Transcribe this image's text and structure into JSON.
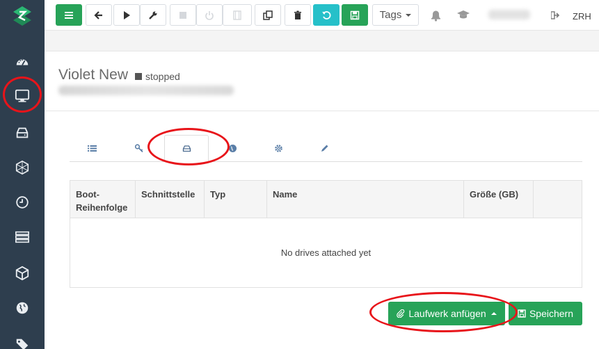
{
  "sidebar": {
    "items": [
      {
        "icon": "dashboard-gauge-icon"
      },
      {
        "icon": "monitor-icon"
      },
      {
        "icon": "hard-drive-icon"
      },
      {
        "icon": "network-hex-icon"
      },
      {
        "icon": "clock-icon"
      },
      {
        "icon": "server-rack-icon"
      },
      {
        "icon": "cube-icon"
      },
      {
        "icon": "globe-icon"
      },
      {
        "icon": "tag-icon"
      }
    ]
  },
  "toolbar": {
    "tags_label": "Tags",
    "region_label": "ZRH"
  },
  "vm": {
    "name": "Violet New",
    "status": "stopped"
  },
  "tabs": [
    {
      "icon": "list-icon"
    },
    {
      "icon": "key-icon"
    },
    {
      "icon": "drive-icon",
      "active": true
    },
    {
      "icon": "globe-icon"
    },
    {
      "icon": "gear-icon"
    },
    {
      "icon": "pencil-icon"
    }
  ],
  "drives_table": {
    "columns": [
      "Boot-\nReihenfolge",
      "Schnittstelle",
      "Typ",
      "Name",
      "Größe (GB)",
      ""
    ],
    "empty_message": "No drives attached yet"
  },
  "actions": {
    "attach_drive_label": "Laufwerk anfügen",
    "save_label": "Speichern"
  },
  "colors": {
    "sidebar_bg": "#2e3e4e",
    "primary_green": "#27a358",
    "teal": "#26c0c9",
    "annotation_red": "#e8141a"
  }
}
